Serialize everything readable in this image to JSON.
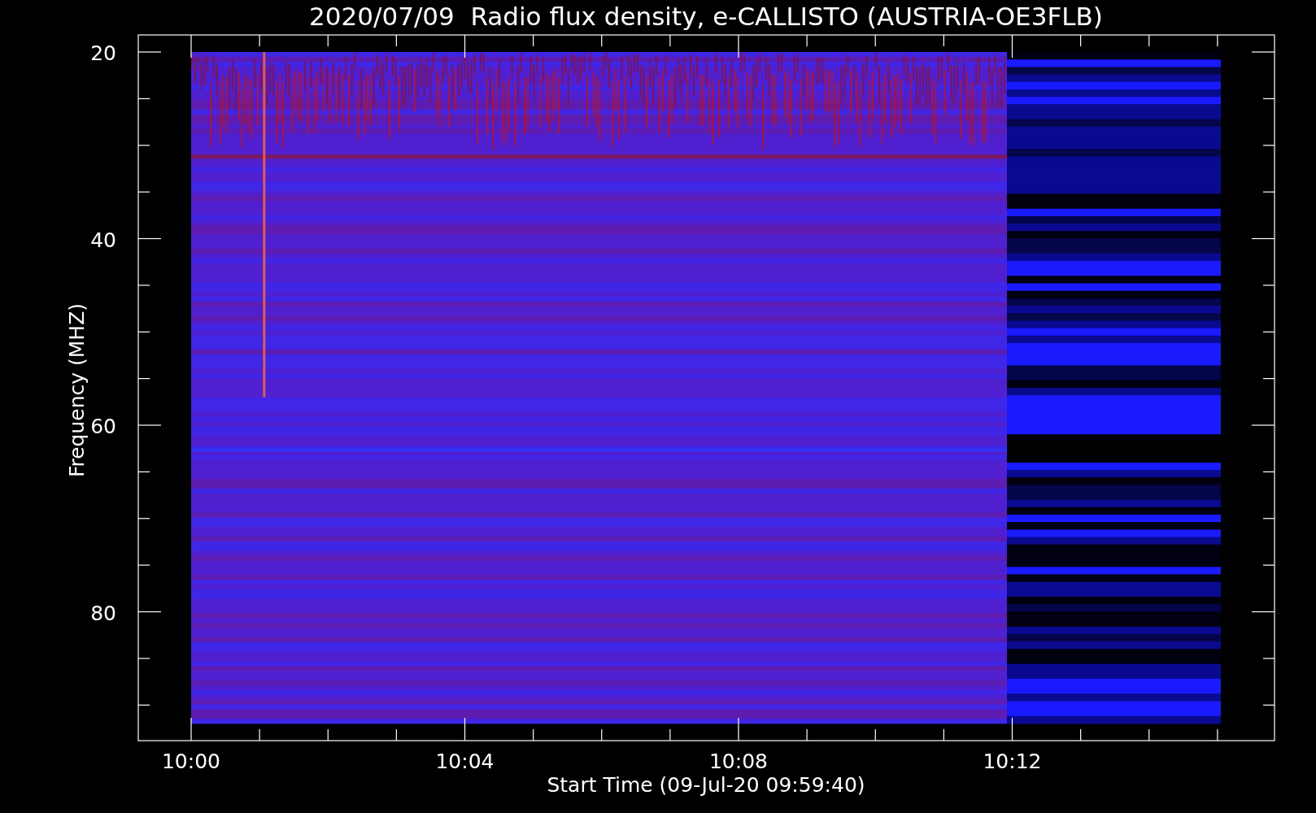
{
  "chart": {
    "title": "2020/07/09  Radio flux density, e-CALLISTO (AUSTRIA-OE3FLB)",
    "ylabel": "Frequency (MHZ)",
    "xlabel": "Start Time (09-Jul-20 09:59:40)",
    "yticks": [
      "20",
      "40",
      "60",
      "80"
    ],
    "xticks": [
      "10:00",
      "10:04",
      "10:08",
      "10:12"
    ]
  }
}
